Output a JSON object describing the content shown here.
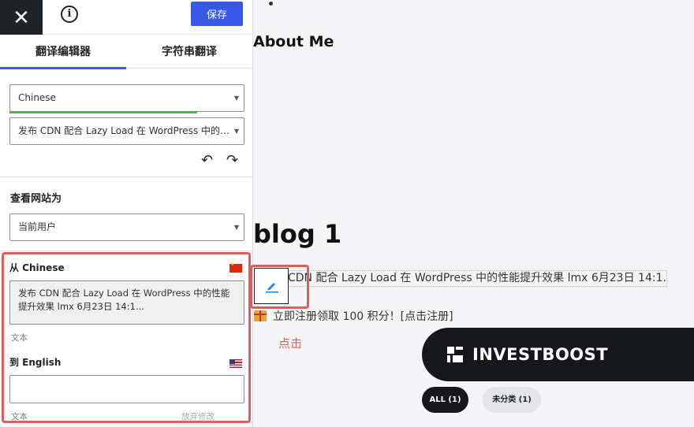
{
  "editor": {
    "close_symbol": "✕",
    "info_symbol": "i",
    "save_label": "保存",
    "tabs": [
      {
        "label": "翻译编辑器",
        "active": true
      },
      {
        "label": "字符串翻译",
        "active": false
      }
    ],
    "language_select": "Chinese",
    "string_select": "发布 CDN 配合 Lazy Load 在 WordPress 中的性能...",
    "undo_symbol": "↶",
    "redo_symbol": "↷",
    "view_as_label": "查看网站为",
    "view_as_select": "当前用户",
    "from_label": "从 Chinese",
    "source_text": "发布 CDN 配合 Lazy Load 在 WordPress 中的性能提升效果 lmx 6月23日 14:1...",
    "source_type": "文本",
    "to_label": "到 English",
    "target_value": "",
    "target_type": "文本",
    "discard_label": "放弃修改",
    "language_progress": 0.8
  },
  "preview": {
    "about_heading": "About Me",
    "blog_title": "blog 1",
    "post_text": "CDN 配合 Lazy Load 在 WordPress 中的性能提升效果 lmx 6月23日 14:1...",
    "promo_text": "立即注册领取 100 积分！[点击注册]",
    "click_note": "点击",
    "brand_name": "INVESTBOOST",
    "filters": [
      {
        "label": "ALL (1)",
        "active": true
      },
      {
        "label": "未分类 (1)",
        "active": false
      }
    ]
  },
  "colors": {
    "primary": "#3858e9",
    "highlight": "#e05c5c",
    "progress": "#4caf50",
    "dark": "#15171c"
  }
}
